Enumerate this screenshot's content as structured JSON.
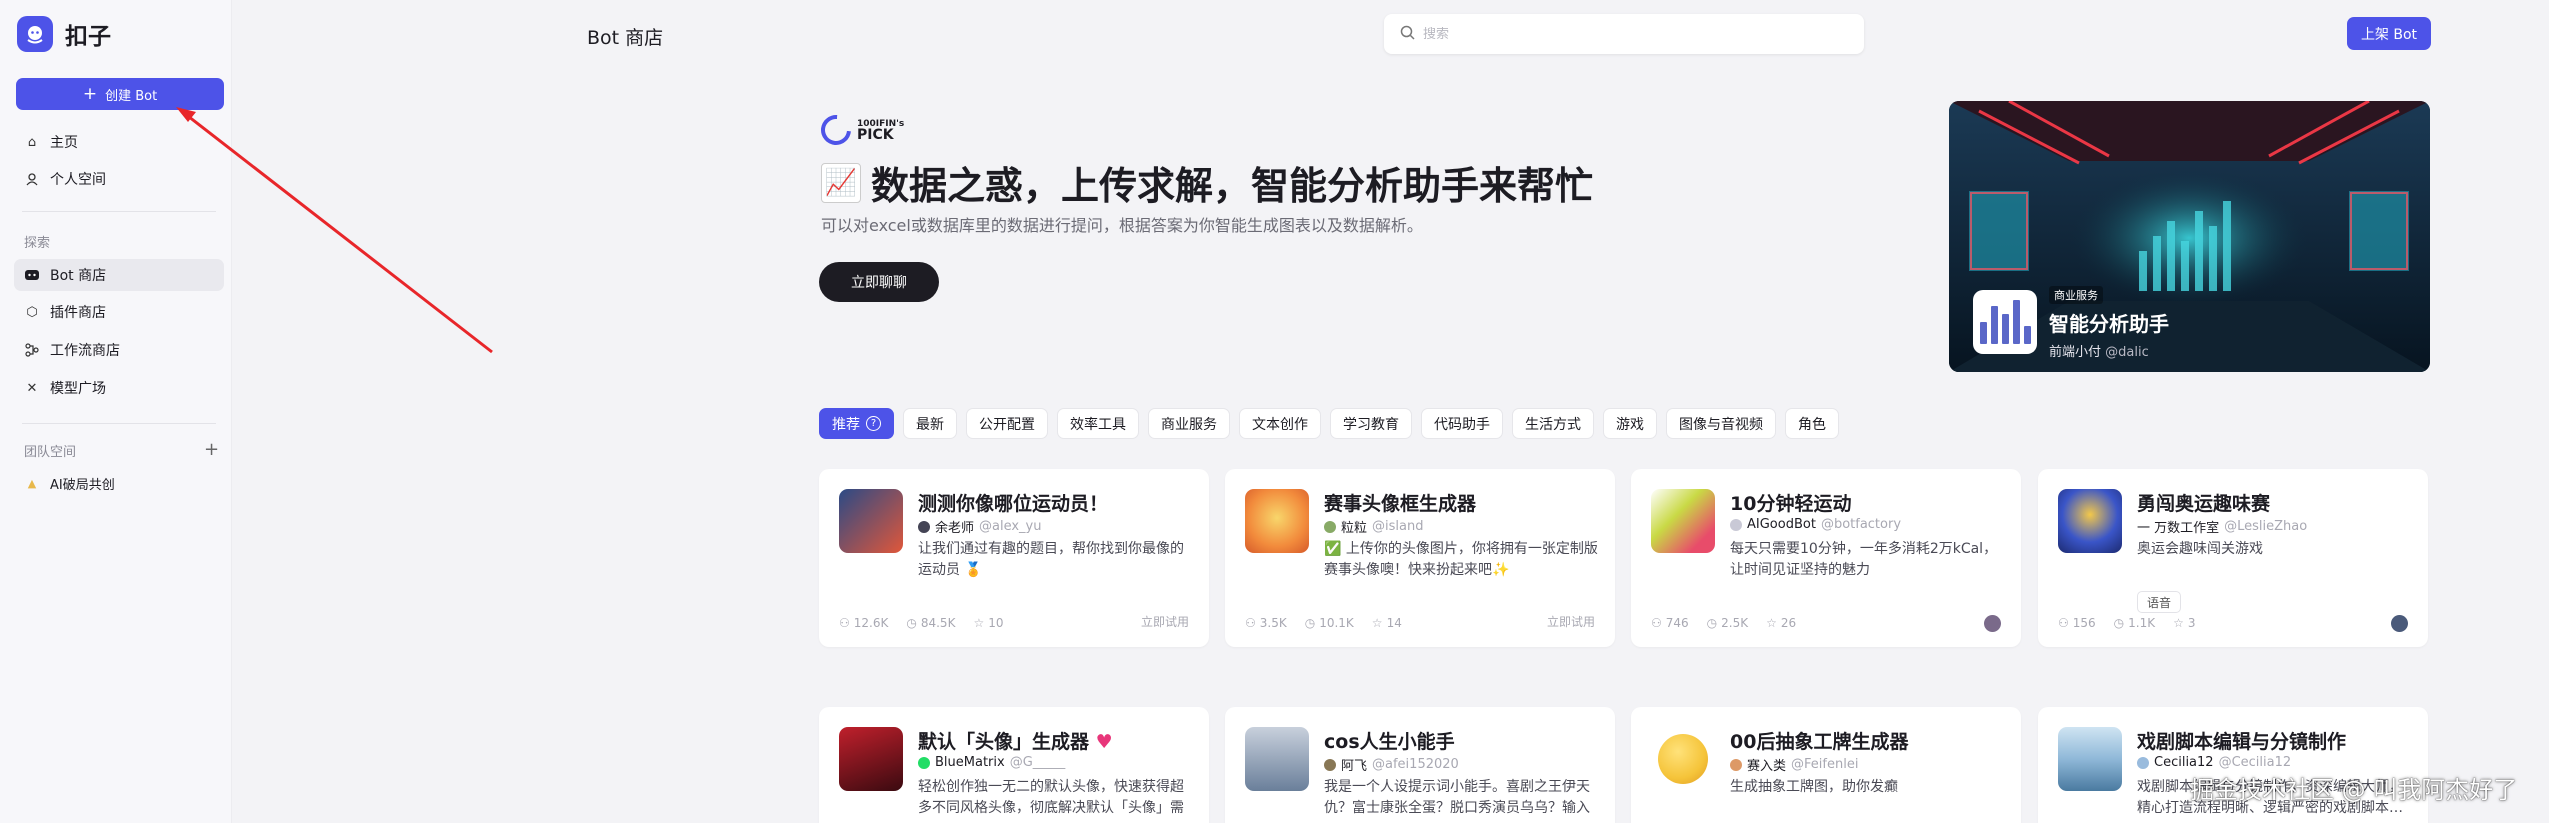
{
  "app": {
    "name": "扣子"
  },
  "sidebar": {
    "create_label": "创建 Bot",
    "home": "主页",
    "personal": "个人空间",
    "explore_label": "探索",
    "explore": [
      "Bot 商店",
      "插件商店",
      "工作流商店",
      "模型广场"
    ],
    "team_label": "团队空间",
    "team_item": "AI破局共创"
  },
  "header": {
    "title": "Bot 商店",
    "search_placeholder": "搜索",
    "publish_label": "上架 Bot"
  },
  "hero": {
    "badge_small": "100IFIN's",
    "badge_big": "PICK",
    "emoji": "📈",
    "title": "数据之惑，上传求解，智能分析助手来帮忙",
    "desc": "可以对excel或数据库里的数据进行提问，根据答案为你智能生成图表以及数据解析。",
    "chat_label": "立即聊聊",
    "app_tag": "商业服务",
    "app_name": "智能分析助手",
    "app_author": "前端小付",
    "app_handle": "@dalic"
  },
  "categories": [
    "推荐",
    "最新",
    "公开配置",
    "效率工具",
    "商业服务",
    "文本创作",
    "学习教育",
    "代码助手",
    "生活方式",
    "游戏",
    "图像与音视频",
    "角色"
  ],
  "cards": [
    {
      "name": "测测你像哪位运动员！",
      "author": "余老师",
      "handle": "@alex_yu",
      "desc": "让我们通过有趣的题目，帮你找到你最像的运动员 🏅",
      "users": "12.6K",
      "chats": "84.5K",
      "stars": "10",
      "try": "立即试用",
      "avatar_color": "#e0573a"
    },
    {
      "name": "赛事头像框生成器",
      "author": "粒粒",
      "handle": "@island",
      "desc": "✅ 上传你的头像图片，你将拥有一张定制版赛事头像噢！快来扮起来吧✨",
      "users": "3.5K",
      "chats": "10.1K",
      "stars": "14",
      "try": "立即试用",
      "avatar_color": "#f28b3c"
    },
    {
      "name": "10分钟轻运动",
      "author": "AIGoodBot",
      "handle": "@botfactory",
      "desc": "每天只需要10分钟，一年多消耗2万kCal，让时间见证坚持的魅力",
      "users": "746",
      "chats": "2.5K",
      "stars": "26",
      "try": "",
      "avatar_color": "#c9d945"
    },
    {
      "name": "勇闯奥运趣味赛",
      "author": "一 万数工作室",
      "handle": "@LeslieZhao",
      "desc": "奥运会趣味闯关游戏",
      "chip": "语音",
      "users": "156",
      "chats": "1.1K",
      "stars": "3",
      "try": "",
      "avatar_color": "#3a55c8"
    },
    {
      "name": "默认「头像」生成器",
      "author": "BlueMatrix",
      "handle": "@G_____",
      "desc": "轻松创作独一无二的默认头像，快速获得超多不同风格头像，彻底解决默认「头像」需",
      "avatar_color": "#c0202c"
    },
    {
      "name": "cos人生小能手",
      "author": "阿飞",
      "handle": "@afei152020",
      "desc": "我是一个人设提示词小能手。喜剧之王伊天仇？富士康张全蛋？脱口秀演员乌乌？输入",
      "avatar_color": "#6a7f9a"
    },
    {
      "name": "00后抽象工牌生成器",
      "author": "赛入类",
      "handle": "@Feifenlei",
      "desc": "生成抽象工牌图，助你发癫",
      "avatar_color": "#f5c43a"
    },
    {
      "name": "戏剧脚本编辑与分镜制作",
      "author": "Cecilia12",
      "handle": "@Cecilia12",
      "desc": "戏剧脚本编辑与分镜制作，资深编辑大师，精心打造流程明晰、逻辑严密的戏剧脚本…",
      "avatar_color": "#8fb8d8"
    }
  ],
  "watermark": "掘金技术社区 @ 叫我阿杰好了"
}
